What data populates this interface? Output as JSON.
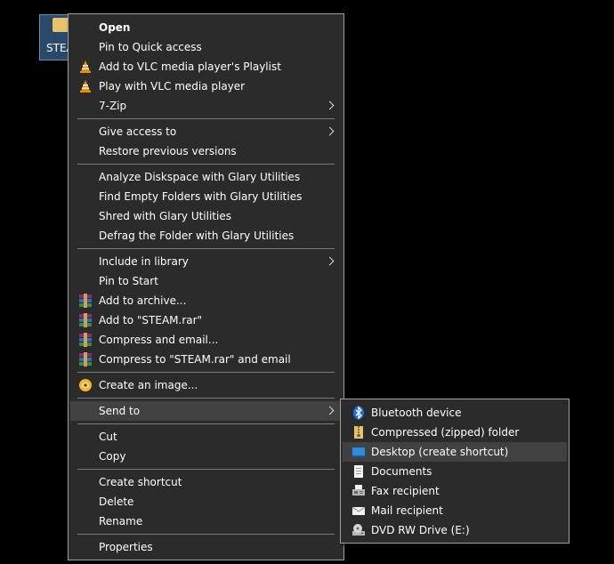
{
  "desktop": {
    "folder_label": "STEAM"
  },
  "context_menu": {
    "items": [
      {
        "label": "Open"
      },
      {
        "label": "Pin to Quick access"
      },
      {
        "label": "Add to VLC media player's Playlist"
      },
      {
        "label": "Play with VLC media player"
      },
      {
        "label": "7-Zip"
      },
      {
        "label": "Give access to"
      },
      {
        "label": "Restore previous versions"
      },
      {
        "label": "Analyze Diskspace with Glary Utilities"
      },
      {
        "label": "Find Empty Folders with Glary Utilities"
      },
      {
        "label": "Shred with Glary Utilities"
      },
      {
        "label": "Defrag the Folder with Glary Utilities"
      },
      {
        "label": "Include in library"
      },
      {
        "label": "Pin to Start"
      },
      {
        "label": "Add to archive..."
      },
      {
        "label": "Add to \"STEAM.rar\""
      },
      {
        "label": "Compress and email..."
      },
      {
        "label": "Compress to \"STEAM.rar\" and email"
      },
      {
        "label": "Create an image..."
      },
      {
        "label": "Send to"
      },
      {
        "label": "Cut"
      },
      {
        "label": "Copy"
      },
      {
        "label": "Create shortcut"
      },
      {
        "label": "Delete"
      },
      {
        "label": "Rename"
      },
      {
        "label": "Properties"
      }
    ]
  },
  "send_to_menu": {
    "items": [
      {
        "label": "Bluetooth device",
        "icon": "bluetooth-icon"
      },
      {
        "label": "Compressed (zipped) folder",
        "icon": "zip-folder-icon"
      },
      {
        "label": "Desktop (create shortcut)",
        "icon": "desktop-icon"
      },
      {
        "label": "Documents",
        "icon": "documents-icon"
      },
      {
        "label": "Fax recipient",
        "icon": "fax-icon"
      },
      {
        "label": "Mail recipient",
        "icon": "mail-icon"
      },
      {
        "label": "DVD RW Drive (E:)",
        "icon": "dvd-drive-icon"
      }
    ]
  },
  "colors": {
    "menu_background": "#2b2b2b",
    "menu_border": "#a0a0a0",
    "highlight": "#414141",
    "separator": "#7a7a7a",
    "text": "#ffffff",
    "desktop_background": "#000000",
    "bluetooth": "#1e6fd6",
    "vlc_orange": "#f08a00"
  }
}
